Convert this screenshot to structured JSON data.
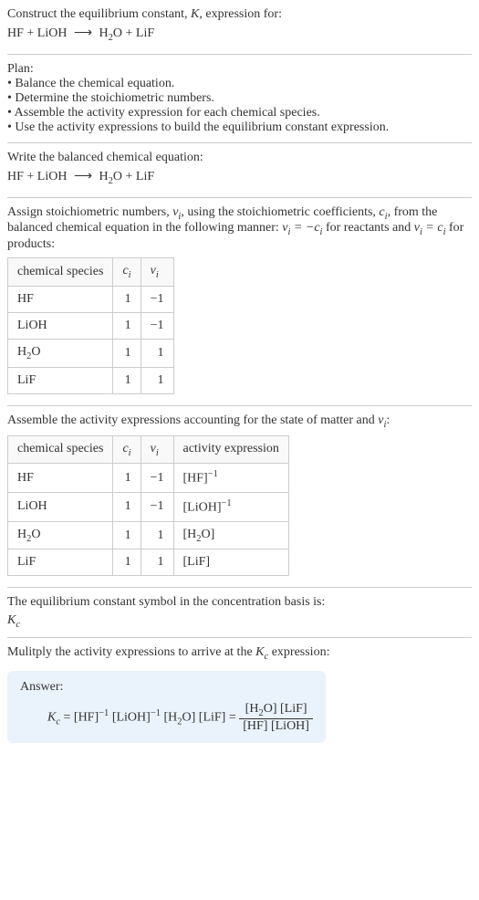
{
  "intro": {
    "line1": "Construct the equilibrium constant, ",
    "k": "K",
    "line1b": ", expression for:"
  },
  "eq1": {
    "reactants": "HF + LiOH",
    "products_pre": "H",
    "products_sub": "2",
    "products_post": "O + LiF"
  },
  "plan": {
    "heading": "Plan:",
    "b1": "• Balance the chemical equation.",
    "b2": "• Determine the stoichiometric numbers.",
    "b3": "• Assemble the activity expression for each chemical species.",
    "b4": "• Use the activity expressions to build the equilibrium constant expression."
  },
  "balanced": {
    "line": "Write the balanced chemical equation:"
  },
  "stoich": {
    "pre": "Assign stoichiometric numbers, ",
    "nu": "ν",
    "i": "i",
    "mid": ", using the stoichiometric coefficients, ",
    "c": "c",
    "mid2": ", from the balanced chemical equation in the following manner: ",
    "eq_r": " for reactants and ",
    "eq_p": " for products:"
  },
  "table1": {
    "h1": "chemical species",
    "h2": "c",
    "h3": "ν",
    "rows": [
      {
        "s": "HF",
        "c": "1",
        "v": "−1"
      },
      {
        "s": "LiOH",
        "c": "1",
        "v": "−1"
      },
      {
        "s_pre": "H",
        "s_sub": "2",
        "s_post": "O",
        "c": "1",
        "v": "1"
      },
      {
        "s": "LiF",
        "c": "1",
        "v": "1"
      }
    ]
  },
  "activity": {
    "line": "Assemble the activity expressions accounting for the state of matter and "
  },
  "table2": {
    "h1": "chemical species",
    "h2": "c",
    "h3": "ν",
    "h4": "activity expression",
    "rows": [
      {
        "s": "HF",
        "c": "1",
        "v": "−1",
        "a": "[HF]",
        "sup": "−1"
      },
      {
        "s": "LiOH",
        "c": "1",
        "v": "−1",
        "a": "[LiOH]",
        "sup": "−1"
      },
      {
        "s_pre": "H",
        "s_sub": "2",
        "s_post": "O",
        "c": "1",
        "v": "1",
        "a_pre": "[H",
        "a_sub": "2",
        "a_post": "O]"
      },
      {
        "s": "LiF",
        "c": "1",
        "v": "1",
        "a": "[LiF]"
      }
    ]
  },
  "concbasis": {
    "line": "The equilibrium constant symbol in the concentration basis is:",
    "K": "K",
    "c": "c"
  },
  "multiply": {
    "pre": "Mulitply the activity expressions to arrive at the ",
    "K": "K",
    "c": "c",
    "post": " expression:"
  },
  "answer": {
    "label": "Answer:",
    "K": "K",
    "c": "c",
    "eq": " = [HF]",
    "sup1": "−1",
    "t2": " [LiOH]",
    "sup2": "−1",
    "t3_pre": " [H",
    "t3_sub": "2",
    "t3_post": "O] [LiF] = ",
    "num_pre": "[H",
    "num_sub": "2",
    "num_post": "O] [LiF]",
    "den": "[HF] [LiOH]"
  }
}
